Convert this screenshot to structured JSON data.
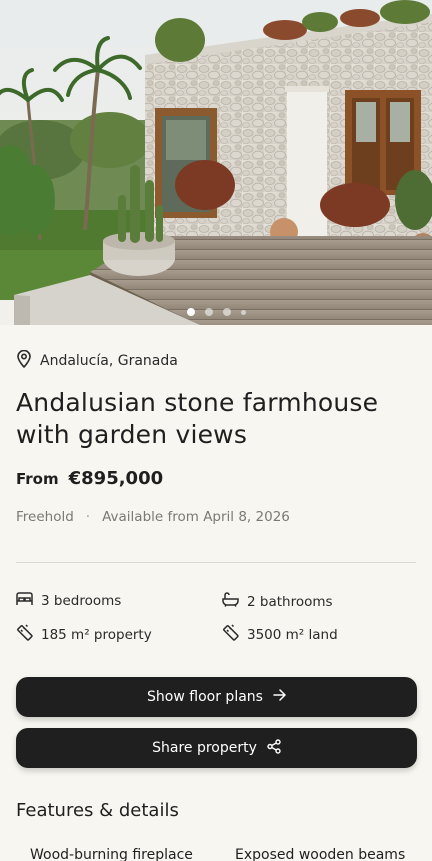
{
  "hero": {
    "image_description": "Stone farmhouse with wooden deck, cactus planter and palm trees",
    "slides": 4,
    "active_slide": 1
  },
  "listing": {
    "location": "Andalucía, Granada",
    "title": "Andalusian stone farmhouse with garden views",
    "price_prefix": "From",
    "price": "€895,000",
    "tenure": "Freehold",
    "separator": "·",
    "availability": "Available from April 8, 2026"
  },
  "specs": {
    "bedrooms": "3 bedrooms",
    "bathrooms": "2 bathrooms",
    "property_size": "185 m² property",
    "land_size": "3500 m² land"
  },
  "actions": {
    "floor_plans_label": "Show floor plans",
    "share_label": "Share property"
  },
  "features": {
    "heading": "Features & details",
    "items": [
      "Wood-burning fireplace",
      "Exposed wooden beams"
    ]
  },
  "colors": {
    "background": "#f7f6f0",
    "button_bg": "#1f1f1f",
    "button_text": "#ffffff",
    "muted_text": "#7a7a74"
  }
}
